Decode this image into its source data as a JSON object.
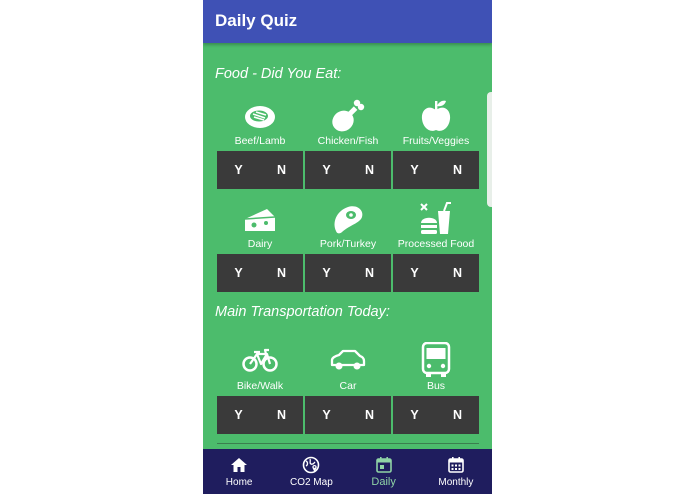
{
  "app": {
    "title": "Daily Quiz"
  },
  "food": {
    "heading": "Food - Did You Eat:",
    "items": [
      {
        "label": "Beef/Lamb",
        "icon": "steak-icon",
        "yes": "Y",
        "no": "N"
      },
      {
        "label": "Chicken/Fish",
        "icon": "drumstick-icon",
        "yes": "Y",
        "no": "N"
      },
      {
        "label": "Fruits/Veggies",
        "icon": "apple-icon",
        "yes": "Y",
        "no": "N"
      },
      {
        "label": "Dairy",
        "icon": "cheese-icon",
        "yes": "Y",
        "no": "N"
      },
      {
        "label": "Pork/Turkey",
        "icon": "ham-icon",
        "yes": "Y",
        "no": "N"
      },
      {
        "label": "Processed Food",
        "icon": "fast-food-icon",
        "yes": "Y",
        "no": "N"
      }
    ]
  },
  "transport": {
    "heading": "Main Transportation Today:",
    "items": [
      {
        "label": "Bike/Walk",
        "icon": "bicycle-icon",
        "yes": "Y",
        "no": "N"
      },
      {
        "label": "Car",
        "icon": "car-icon",
        "yes": "Y",
        "no": "N"
      },
      {
        "label": "Bus",
        "icon": "bus-icon",
        "yes": "Y",
        "no": "N"
      }
    ]
  },
  "nav": {
    "items": [
      {
        "label": "Home",
        "icon": "home-icon"
      },
      {
        "label": "CO2 Map",
        "icon": "globe-map-icon"
      },
      {
        "label": "Daily",
        "icon": "calendar-day-icon",
        "active": true
      },
      {
        "label": "Monthly",
        "icon": "calendar-month-icon"
      }
    ]
  },
  "colors": {
    "appbar": "#3f51b5",
    "background": "#4cbc6c",
    "button": "#3a3a3a",
    "nav": "#1f1d5e",
    "nav_active": "#8fd3a6"
  }
}
